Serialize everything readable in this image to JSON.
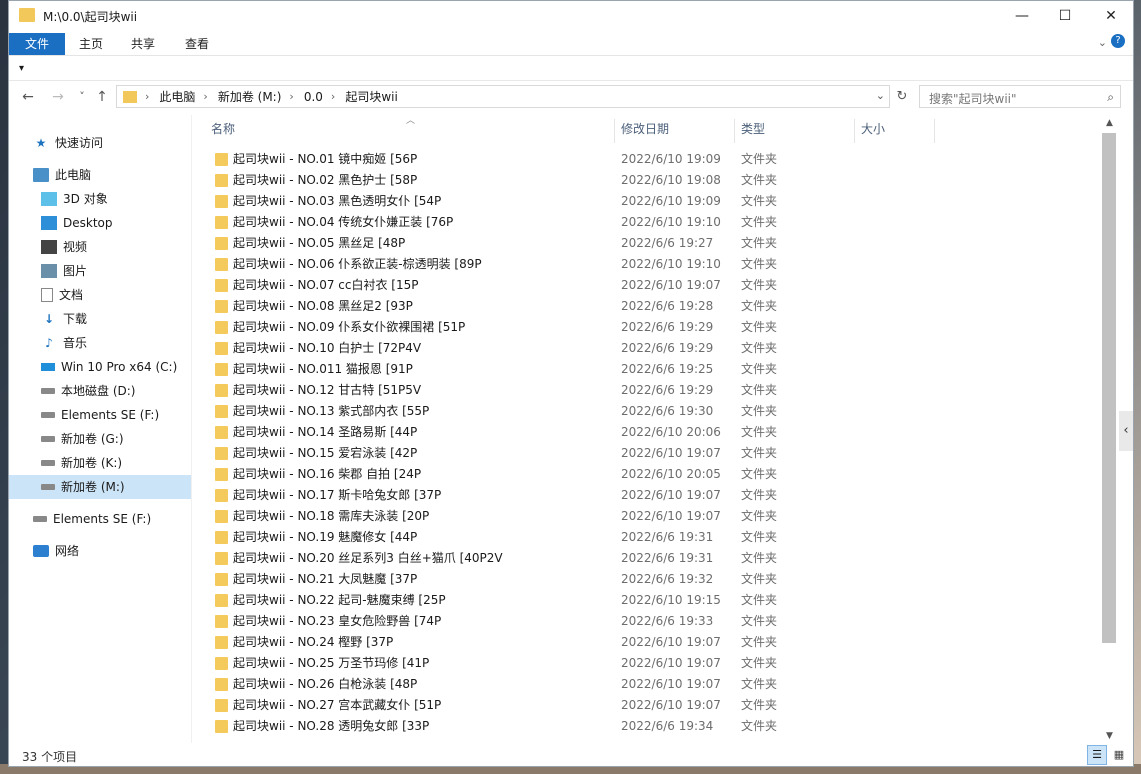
{
  "window": {
    "title": "M:\\0.0\\起司块wii",
    "minimize": "—",
    "maximize": "☐",
    "close": "✕"
  },
  "ribbon": {
    "tabs": [
      "文件",
      "主页",
      "共享",
      "查看"
    ],
    "expand_icon": "chevron-down-icon",
    "help_icon": "?"
  },
  "qat": {
    "arrow": "▾"
  },
  "nav": {
    "back": "←",
    "forward": "→",
    "recent": "˅",
    "up": "↑",
    "breadcrumbs": [
      "此电脑",
      "新加卷 (M:)",
      "0.0",
      "起司块wii"
    ],
    "separator": "›",
    "refresh": "↻",
    "search_placeholder": "搜索\"起司块wii\""
  },
  "sidebar": {
    "items": [
      {
        "label": "快速访问",
        "icon": "star-icon"
      },
      {
        "label": "此电脑",
        "icon": "computer-icon"
      },
      {
        "label": "3D 对象",
        "icon": "3d-objects-icon"
      },
      {
        "label": "Desktop",
        "icon": "desktop-icon"
      },
      {
        "label": "视频",
        "icon": "video-icon"
      },
      {
        "label": "图片",
        "icon": "pictures-icon"
      },
      {
        "label": "文档",
        "icon": "documents-icon"
      },
      {
        "label": "下载",
        "icon": "downloads-icon"
      },
      {
        "label": "音乐",
        "icon": "music-icon"
      },
      {
        "label": "Win 10 Pro x64 (C:)",
        "icon": "windows-drive-icon"
      },
      {
        "label": "本地磁盘 (D:)",
        "icon": "drive-icon"
      },
      {
        "label": "Elements SE (F:)",
        "icon": "drive-icon"
      },
      {
        "label": "新加卷 (G:)",
        "icon": "drive-icon"
      },
      {
        "label": "新加卷 (K:)",
        "icon": "drive-icon"
      },
      {
        "label": "新加卷 (M:)",
        "icon": "drive-icon",
        "selected": true
      },
      {
        "label": "Elements SE (F:)",
        "icon": "drive-icon"
      },
      {
        "label": "网络",
        "icon": "network-icon"
      }
    ]
  },
  "columns": {
    "name": "名称",
    "date": "修改日期",
    "type": "类型",
    "size": "大小"
  },
  "files": [
    {
      "name": "起司块wii - NO.01 镜中痴姬 [56P",
      "date": "2022/6/10 19:09",
      "type": "文件夹"
    },
    {
      "name": "起司块wii - NO.02 黑色护士 [58P",
      "date": "2022/6/10 19:08",
      "type": "文件夹"
    },
    {
      "name": "起司块wii - NO.03 黑色透明女仆 [54P",
      "date": "2022/6/10 19:09",
      "type": "文件夹"
    },
    {
      "name": "起司块wii - NO.04 传统女仆嫌正装 [76P",
      "date": "2022/6/10 19:10",
      "type": "文件夹"
    },
    {
      "name": "起司块wii - NO.05 黑丝足 [48P",
      "date": "2022/6/6 19:27",
      "type": "文件夹"
    },
    {
      "name": "起司块wii - NO.06 仆系欲正装-棕透明装 [89P",
      "date": "2022/6/10 19:10",
      "type": "文件夹"
    },
    {
      "name": "起司块wii - NO.07 cc白衬衣 [15P",
      "date": "2022/6/10 19:07",
      "type": "文件夹"
    },
    {
      "name": "起司块wii - NO.08 黑丝足2 [93P",
      "date": "2022/6/6 19:28",
      "type": "文件夹"
    },
    {
      "name": "起司块wii - NO.09 仆系女仆欲裸围裙 [51P",
      "date": "2022/6/6 19:29",
      "type": "文件夹"
    },
    {
      "name": "起司块wii - NO.10 白护士 [72P4V",
      "date": "2022/6/6 19:29",
      "type": "文件夹"
    },
    {
      "name": "起司块wii - NO.011 猫报恩 [91P",
      "date": "2022/6/6 19:25",
      "type": "文件夹"
    },
    {
      "name": "起司块wii - NO.12 甘古特 [51P5V",
      "date": "2022/6/6 19:29",
      "type": "文件夹"
    },
    {
      "name": "起司块wii - NO.13 紫式部内衣 [55P",
      "date": "2022/6/6 19:30",
      "type": "文件夹"
    },
    {
      "name": "起司块wii - NO.14 圣路易斯 [44P",
      "date": "2022/6/10 20:06",
      "type": "文件夹"
    },
    {
      "name": "起司块wii - NO.15 爱宕泳装 [42P",
      "date": "2022/6/10 19:07",
      "type": "文件夹"
    },
    {
      "name": "起司块wii - NO.16 柴郡 自拍 [24P",
      "date": "2022/6/10 20:05",
      "type": "文件夹"
    },
    {
      "name": "起司块wii - NO.17 斯卡哈兔女郎 [37P",
      "date": "2022/6/10 19:07",
      "type": "文件夹"
    },
    {
      "name": "起司块wii - NO.18 需库夫泳装 [20P",
      "date": "2022/6/10 19:07",
      "type": "文件夹"
    },
    {
      "name": "起司块wii - NO.19 魅魔修女 [44P",
      "date": "2022/6/6 19:31",
      "type": "文件夹"
    },
    {
      "name": "起司块wii - NO.20 丝足系列3 白丝+猫爪 [40P2V",
      "date": "2022/6/6 19:31",
      "type": "文件夹"
    },
    {
      "name": "起司块wii - NO.21 大凤魅魔 [37P",
      "date": "2022/6/6 19:32",
      "type": "文件夹"
    },
    {
      "name": "起司块wii - NO.22 起司-魅魔束缚 [25P",
      "date": "2022/6/10 19:15",
      "type": "文件夹"
    },
    {
      "name": "起司块wii - NO.23 皇女危险野兽 [74P",
      "date": "2022/6/6 19:33",
      "type": "文件夹"
    },
    {
      "name": "起司块wii - NO.24 樫野 [37P",
      "date": "2022/6/10 19:07",
      "type": "文件夹"
    },
    {
      "name": "起司块wii - NO.25 万圣节玛修 [41P",
      "date": "2022/6/10 19:07",
      "type": "文件夹"
    },
    {
      "name": "起司块wii - NO.26 白枪泳装 [48P",
      "date": "2022/6/10 19:07",
      "type": "文件夹"
    },
    {
      "name": "起司块wii - NO.27 宫本武藏女仆 [51P",
      "date": "2022/6/10 19:07",
      "type": "文件夹"
    },
    {
      "name": "起司块wii - NO.28 透明兔女郎 [33P",
      "date": "2022/6/6 19:34",
      "type": "文件夹"
    }
  ],
  "scrollbar": {
    "up": "▲",
    "down": "▼"
  },
  "side_toggle": "‹",
  "status": {
    "count_text": "33 个项目",
    "details_view_icon": "details-view-icon",
    "tiles_view_icon": "tiles-view-icon"
  }
}
